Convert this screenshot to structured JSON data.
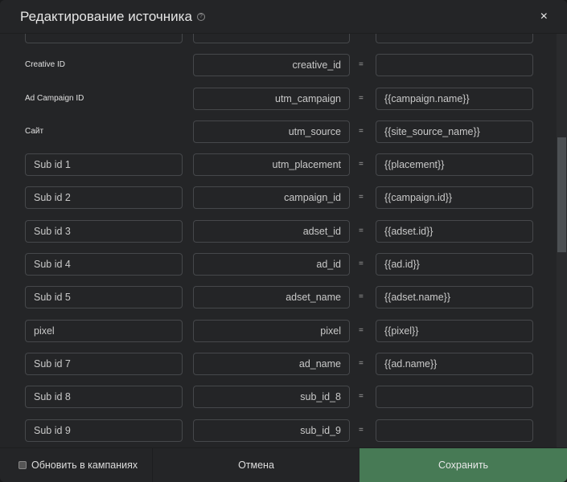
{
  "header": {
    "title": "Редактирование источника",
    "help_icon": "question-circle-icon",
    "close_icon": "close-icon",
    "close": "×"
  },
  "eq": "=",
  "rows": [
    {
      "type": "input",
      "name": "",
      "param": "",
      "value": ""
    },
    {
      "type": "label",
      "name": "Creative ID",
      "param": "creative_id",
      "value": ""
    },
    {
      "type": "label",
      "name": "Ad Campaign ID",
      "param": "utm_campaign",
      "value": "{{campaign.name}}"
    },
    {
      "type": "label",
      "name": "Сайт",
      "param": "utm_source",
      "value": "{{site_source_name}}"
    },
    {
      "type": "input",
      "name": "Sub id 1",
      "param": "utm_placement",
      "value": "{{placement}}"
    },
    {
      "type": "input",
      "name": "Sub id 2",
      "param": "campaign_id",
      "value": "{{campaign.id}}"
    },
    {
      "type": "input",
      "name": "Sub id 3",
      "param": "adset_id",
      "value": "{{adset.id}}"
    },
    {
      "type": "input",
      "name": "Sub id 4",
      "param": "ad_id",
      "value": "{{ad.id}}"
    },
    {
      "type": "input",
      "name": "Sub id 5",
      "param": "adset_name",
      "value": "{{adset.name}}"
    },
    {
      "type": "input",
      "name": "pixel",
      "param": "pixel",
      "value": "{{pixel}}"
    },
    {
      "type": "input",
      "name": "Sub id 7",
      "param": "ad_name",
      "value": "{{ad.name}}"
    },
    {
      "type": "input",
      "name": "Sub id 8",
      "param": "sub_id_8",
      "value": ""
    },
    {
      "type": "input",
      "name": "Sub id 9",
      "param": "sub_id_9",
      "value": ""
    },
    {
      "type": "input",
      "name": "",
      "param": "",
      "value": ""
    }
  ],
  "footer": {
    "update_label": "Обновить в кампаниях",
    "update_checked": false,
    "cancel": "Отмена",
    "save": "Сохранить"
  },
  "colors": {
    "background": "#242527",
    "save": "#477a55",
    "border": "#46484b"
  }
}
